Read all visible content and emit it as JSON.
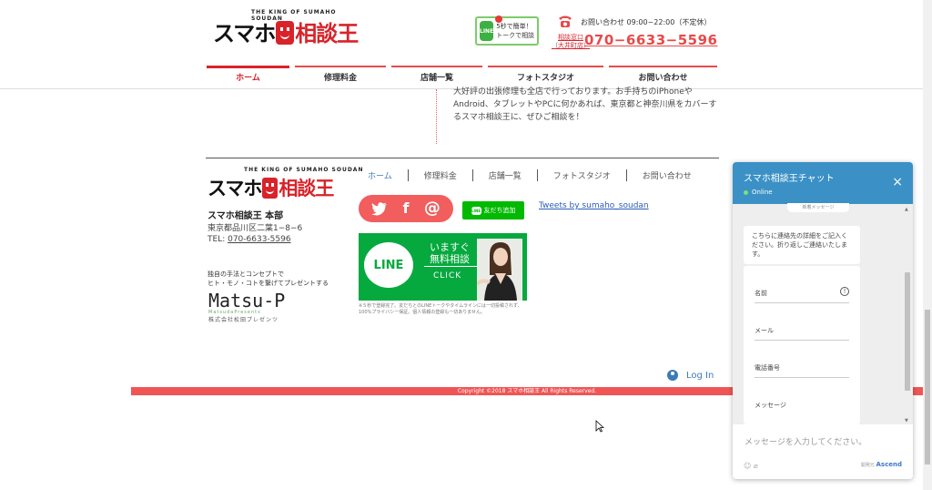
{
  "header": {
    "logo_tag": "THE KING OF SUMAHO SOUDAN",
    "logo_part1": "スマホ",
    "logo_part2": "相談王",
    "line_badge_text": "5秒で簡単！トークで相談",
    "line_badge_icon": "LINE",
    "hours": "お問い合わせ 09:00~22:00（不定休）",
    "office_line1": "相談窓口",
    "office_line2": "（大井町店）",
    "phone": "070−6633−5596"
  },
  "nav": {
    "items": [
      "ホーム",
      "修理料金",
      "店舗一覧",
      "フォトスタジオ",
      "お問い合わせ"
    ]
  },
  "main": {
    "body_text": "大好評の出張修理も全店で行っております。お手持ちのiPhoneやAndroid、タブレットやPCに何かあれば、東京都と神奈川県をカバーするスマホ相談王に、ぜひご相談を！"
  },
  "footer": {
    "logo_tag": "THE KING OF SUMAHO SOUDAN",
    "logo_part1": "スマホ",
    "logo_part2": "相談王",
    "hq": "スマホ相談王 本部",
    "address": "東京都品川区二葉1−8−6",
    "tel_label": "TEL:",
    "tel": "070-6633-5596",
    "tagline_line1": "独自の手法とコンセプトで",
    "tagline_line2": "ヒト・モノ・コトを繋げてプレゼントする",
    "matsu_big": "Matsu-P",
    "matsu_sub": "MatsudaPresents",
    "matsu_corp": "株式会社松田プレゼンツ",
    "nav": [
      "ホーム",
      "修理料金",
      "店舗一覧",
      "フォトスタジオ",
      "お問い合わせ"
    ],
    "social": {
      "twitter": "𝕥",
      "facebook": "f",
      "email": "@"
    },
    "friend_button": "友だち追加",
    "friend_icon": "LINE",
    "tweets_link": "Tweets by sumaho_soudan",
    "banner": {
      "logo": "LINE",
      "line1": "いますぐ",
      "line2": "無料相談",
      "click": "CLICK"
    },
    "note": "※５秒で登録完了。友だちとのLINEトークやタイムラインには一切投稿されず、100%プライバシー保証。個人情報の登録も一切ありません。",
    "login": "Log In",
    "copyright": "Copyright ©2018 スマホ相談王 All Rights Reserved."
  },
  "chat": {
    "title": "スマホ相談王チャット",
    "status": "Online",
    "close": "×",
    "new_message": "新着メッセージ",
    "bubble": "こちらに連絡先の詳細をご記入ください。折り返しご連絡いたします。",
    "fields": [
      "名前",
      "メール",
      "電話番号",
      "メッセージ"
    ],
    "input_placeholder": "メッセージを入力してください。",
    "tools": "☺ ⌀",
    "powered_label": "開発元",
    "powered_brand": "Ascend"
  },
  "colors": {
    "accent_red": "#d8232a",
    "chat_blue": "#3b91c6",
    "line_green": "#06a93e"
  }
}
